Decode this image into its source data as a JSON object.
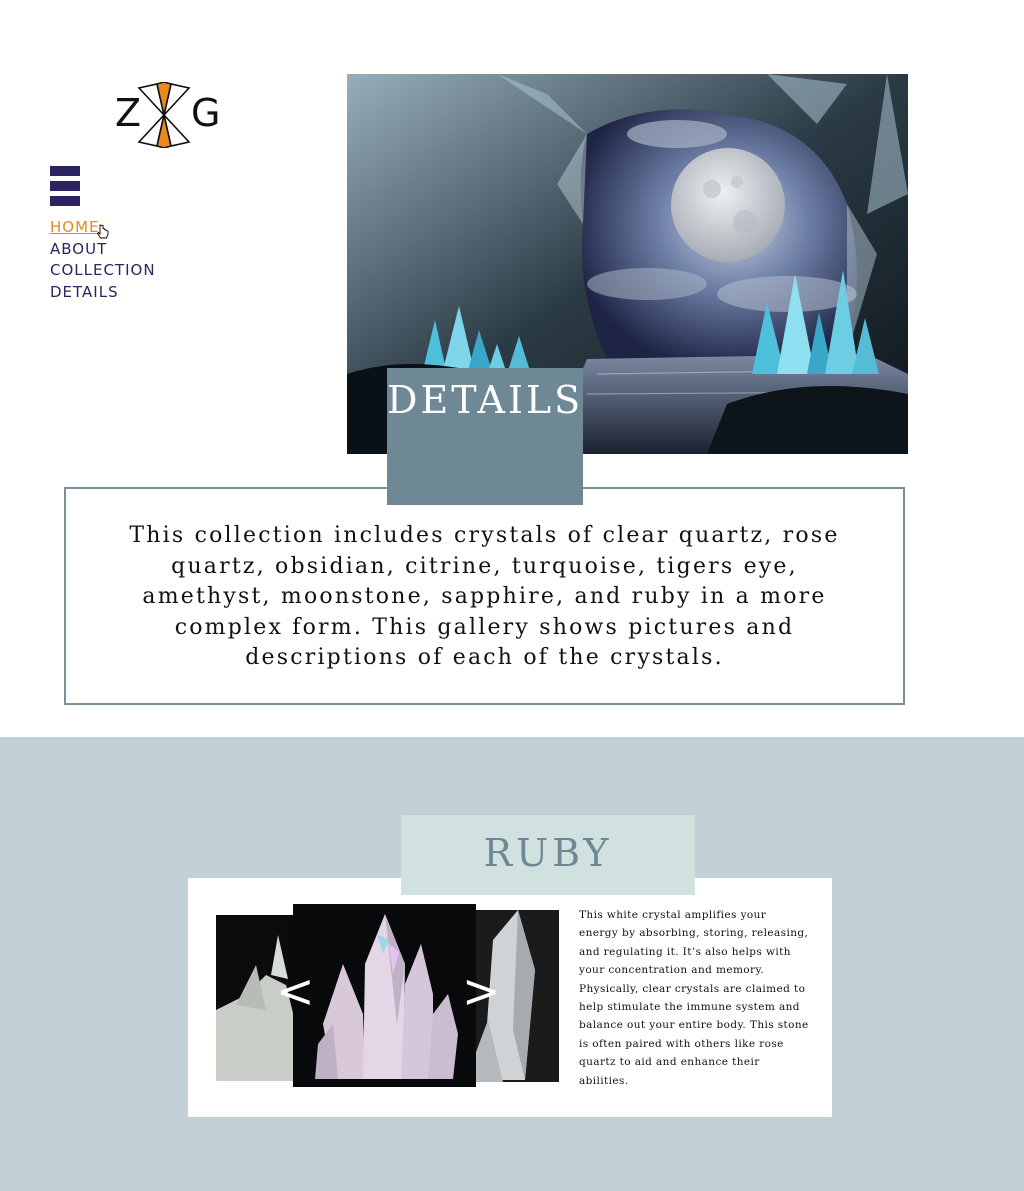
{
  "logo": {
    "left_letter": "Z",
    "right_letter": "G"
  },
  "nav": {
    "items": [
      {
        "label": "HOME",
        "active": true
      },
      {
        "label": "ABOUT",
        "active": false
      },
      {
        "label": "COLLECTION",
        "active": false
      },
      {
        "label": "DETAILS",
        "active": false
      }
    ]
  },
  "hero": {
    "heading": "DETAILS"
  },
  "intro": {
    "text": "This collection includes crystals of clear quartz, rose quartz, obsidian, citrine, turquoise, tigers eye, amethyst, moonstone, sapphire, and ruby in a more complex form. This gallery shows pictures and descriptions of each of the crystals."
  },
  "gallery": {
    "title": "RUBY",
    "prev_label": "<",
    "next_label": ">",
    "description": "This white crystal amplifies your energy by absorbing, storing, releasing, and regulating it. It’s also helps with your concentration and memory. Physically, clear crystals are claimed to help stimulate the immune system and balance out your entire body. This stone is often paired with others like rose quartz to aid and enhance their abilities."
  },
  "colors": {
    "accent_orange": "#e88a1c",
    "nav_navy": "#2a2460",
    "slate": "#6e8896",
    "gallery_bg": "#c3d0d7",
    "tab_mint": "#d1e1e0"
  },
  "icons": [
    "logo-mark-icon",
    "hamburger-menu-icon",
    "pointer-cursor-icon"
  ]
}
